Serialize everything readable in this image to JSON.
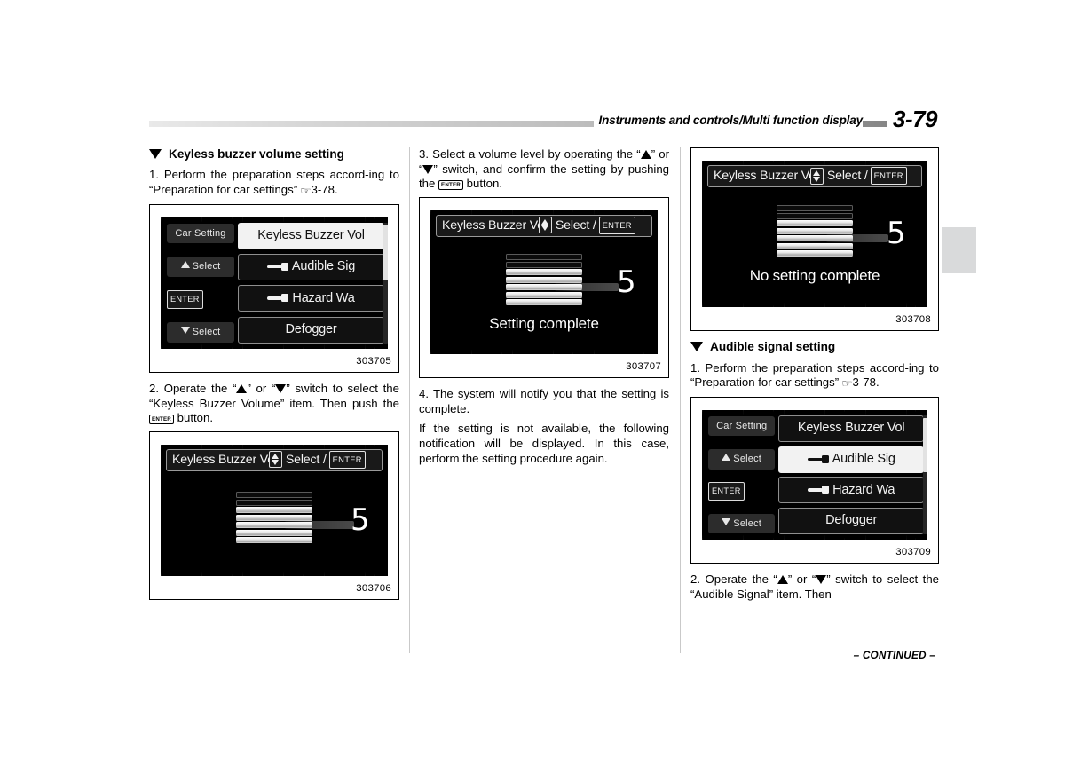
{
  "header": {
    "title": "Instruments and controls/Multi function display",
    "page_number": "3-79"
  },
  "footer": {
    "continued": "– CONTINUED –"
  },
  "column1": {
    "section_heading": "Keyless buzzer volume setting",
    "step1_a": "1.   Perform the preparation steps accord-",
    "step1_b": "ing to “Preparation for car settings” ",
    "step1_ref": "3-78.",
    "figure1": {
      "caption": "303705",
      "screen": {
        "left_buttons": {
          "title": "Car Setting",
          "select_up": "Select",
          "enter": "ENTER",
          "select_down": "Select"
        },
        "items": [
          {
            "label": "Keyless Buzzer Vol",
            "icon": "none",
            "selected": true
          },
          {
            "label": "Audible Sig",
            "icon": "key-icon",
            "selected": false
          },
          {
            "label": "Hazard Wa",
            "icon": "key-icon",
            "selected": false
          },
          {
            "label": "Defogger",
            "icon": "none",
            "selected": false
          }
        ]
      }
    },
    "step2_a": "2. Operate the “",
    "step2_b": "” or “",
    "step2_c": "” switch to select the “Keyless Buzzer Volume” item. Then push the ",
    "step2_d": " button.",
    "figure2": {
      "caption": "303706",
      "screen": {
        "title": "Keyless Buzzer Vo",
        "select_label": "Select /",
        "enter": "ENTER",
        "level": "5",
        "bars_total": 7,
        "bars_lit": 5,
        "status": ""
      }
    }
  },
  "column2": {
    "step3_a": "3.   Select a volume level by operating the “",
    "step3_b": "” or “",
    "step3_c": "” switch, and confirm the setting by pushing the ",
    "step3_d": " button.",
    "figure3": {
      "caption": "303707",
      "screen": {
        "title": "Keyless Buzzer Vo",
        "select_label": "Select /",
        "enter": "ENTER",
        "level": "5",
        "bars_total": 7,
        "bars_lit": 5,
        "status": "Setting complete"
      }
    },
    "step4": "4. The system will notify you that the setting is complete.",
    "note": "If the setting is not available, the following notification will be displayed. In this case, perform the setting procedure again."
  },
  "column3": {
    "figure4": {
      "caption": "303708",
      "screen": {
        "title": "Keyless Buzzer Vo",
        "select_label": "Select /",
        "enter": "ENTER",
        "level": "5",
        "bars_total": 7,
        "bars_lit": 5,
        "status": "No setting complete"
      }
    },
    "section_heading": "Audible signal setting",
    "step1_a": "1.   Perform the preparation steps accord-",
    "step1_b": "ing to “Preparation for car settings” ",
    "step1_ref": "3-78.",
    "figure5": {
      "caption": "303709",
      "screen": {
        "left_buttons": {
          "title": "Car Setting",
          "select_up": "Select",
          "enter": "ENTER",
          "select_down": "Select"
        },
        "items": [
          {
            "label": "Keyless Buzzer Vol",
            "icon": "none",
            "selected": false
          },
          {
            "label": "Audible Sig",
            "icon": "key-icon",
            "selected": true
          },
          {
            "label": "Hazard Wa",
            "icon": "key-icon",
            "selected": false
          },
          {
            "label": "Defogger",
            "icon": "none",
            "selected": false
          }
        ]
      }
    },
    "step2_a": "2. Operate the “",
    "step2_b": "” or “",
    "step2_c": "” switch to select the “Audible Signal” item. Then"
  }
}
